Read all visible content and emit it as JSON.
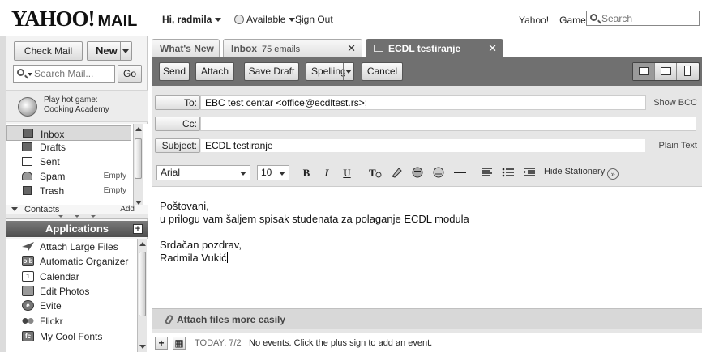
{
  "header": {
    "logo": "YAHOO!",
    "logo_suffix": "MAIL",
    "greeting": "Hi, radmila",
    "status": "Available",
    "sign_out": "Sign Out",
    "links": [
      "Yahoo!",
      "Games"
    ],
    "search_placeholder": "Search"
  },
  "sidebar": {
    "check_mail": "Check Mail",
    "new_label": "New",
    "search_placeholder": "Search Mail...",
    "go_label": "Go",
    "promo": {
      "line1": "Play hot game:",
      "line2": "Cooking Academy"
    },
    "folders": [
      {
        "name": "Inbox",
        "badge": ""
      },
      {
        "name": "Drafts",
        "badge": ""
      },
      {
        "name": "Sent",
        "badge": ""
      },
      {
        "name": "Spam",
        "badge": "Empty"
      },
      {
        "name": "Trash",
        "badge": "Empty"
      }
    ],
    "contacts": {
      "label": "Contacts",
      "add": "Add"
    },
    "applications_title": "Applications",
    "applications": [
      {
        "name": "Attach Large Files",
        "icon": "paper-plane-icon"
      },
      {
        "name": "Automatic Organizer",
        "icon": "oib-icon",
        "glyph": "oib"
      },
      {
        "name": "Calendar",
        "icon": "calendar-icon",
        "glyph": "1"
      },
      {
        "name": "Edit Photos",
        "icon": "photo-icon"
      },
      {
        "name": "Evite",
        "icon": "evite-icon",
        "glyph": "e"
      },
      {
        "name": "Flickr",
        "icon": "flickr-icon"
      },
      {
        "name": "My Cool Fonts",
        "icon": "fonts-icon",
        "glyph": "fc"
      }
    ]
  },
  "tabs": [
    {
      "label": "What's New",
      "count": "",
      "closable": false
    },
    {
      "label": "Inbox",
      "count": "75 emails",
      "closable": true
    },
    {
      "label": "ECDL testiranje",
      "count": "",
      "closable": true,
      "active": true
    }
  ],
  "toolbar": {
    "send": "Send",
    "attach": "Attach",
    "save_draft": "Save Draft",
    "spelling": "Spelling",
    "cancel": "Cancel"
  },
  "compose": {
    "to_label": "To:",
    "to_value": "EBC test centar <office@ecdltest.rs>;",
    "show_bcc": "Show BCC",
    "cc_label": "Cc:",
    "cc_value": "",
    "subject_label": "Subject:",
    "subject_value": "ECDL testiranje",
    "plain_text": "Plain Text",
    "font": "Arial",
    "size": "10",
    "hide_stationery": "Hide Stationery",
    "body_lines": [
      "Poštovani,",
      "u prilogu vam šaljem spisak studenata za polaganje ECDL modula",
      "",
      "Srdačan pozdrav,",
      "Radmila Vukić"
    ],
    "attach_hint": "Attach files more easily"
  },
  "calendar": {
    "today": "TODAY: 7/2",
    "message": "No events. Click the plus sign to add an event."
  }
}
